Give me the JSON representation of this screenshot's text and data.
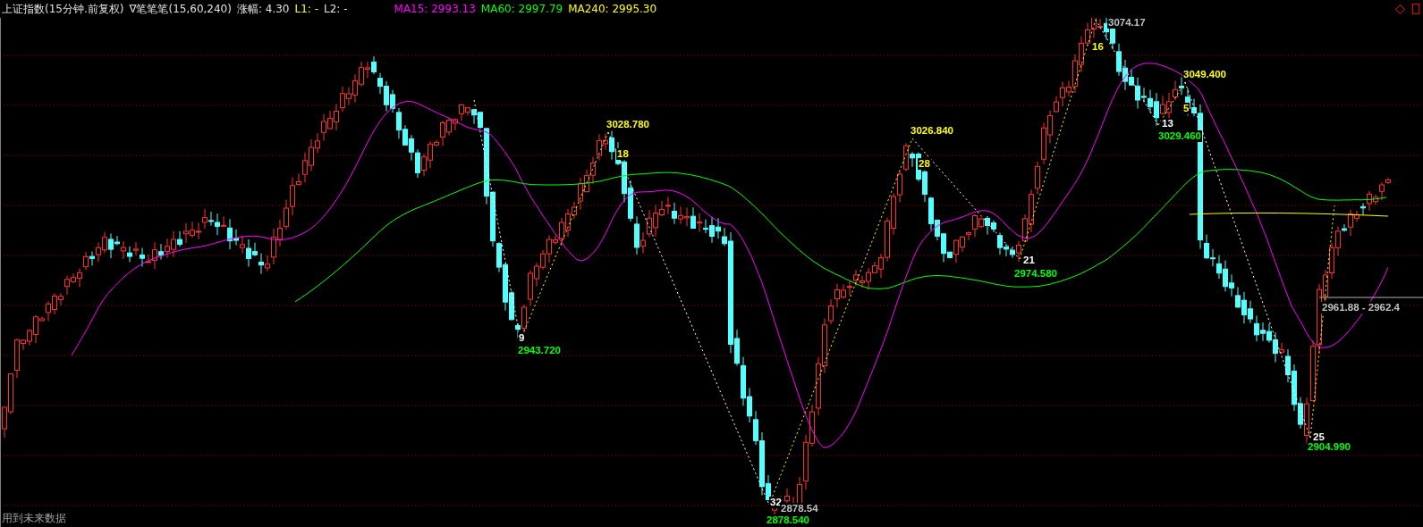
{
  "header": {
    "title": "上证指数(15分钟.前复权)",
    "indicator": "∇笔笔笔(15,60,240)",
    "change": "涨幅: 4.30",
    "l1": "L1: -",
    "l2": "L2: -",
    "moving_averages": [
      {
        "label": "MA15: 2993.13",
        "color": "#ff00ff"
      },
      {
        "label": "MA60: 2997.79",
        "color": "#00ff00"
      },
      {
        "label": "MA240: 2995.30",
        "color": "#ffff00"
      }
    ]
  },
  "annotations": [
    {
      "text": "3074.17",
      "color": "#c0c0c0"
    },
    {
      "text": "16",
      "color": "#ffff00"
    },
    {
      "text": "3049.400",
      "color": "#ffff00"
    },
    {
      "text": "5",
      "color": "#ffff00"
    },
    {
      "text": "13",
      "color": "#ffffff"
    },
    {
      "text": "3029.460",
      "color": "#00ff00"
    },
    {
      "text": "3028.780",
      "color": "#ffff00"
    },
    {
      "text": "18",
      "color": "#ffff00"
    },
    {
      "text": "3026.840",
      "color": "#ffff00"
    },
    {
      "text": "28",
      "color": "#ffff00"
    },
    {
      "text": "9",
      "color": "#ffffff"
    },
    {
      "text": "2943.720",
      "color": "#00ff00"
    },
    {
      "text": "21",
      "color": "#ffffff"
    },
    {
      "text": "2974.580",
      "color": "#00ff00"
    },
    {
      "text": "32",
      "color": "#ffffff"
    },
    {
      "text": "2878.54",
      "color": "#c0c0c0"
    },
    {
      "text": "2878.540",
      "color": "#00ff00"
    },
    {
      "text": "25",
      "color": "#ffffff"
    },
    {
      "text": "2904.990",
      "color": "#00ff00"
    },
    {
      "text": "2961.88 - 2962.4",
      "color": "#c0c0c0"
    }
  ],
  "footer": "用到未来数据"
}
